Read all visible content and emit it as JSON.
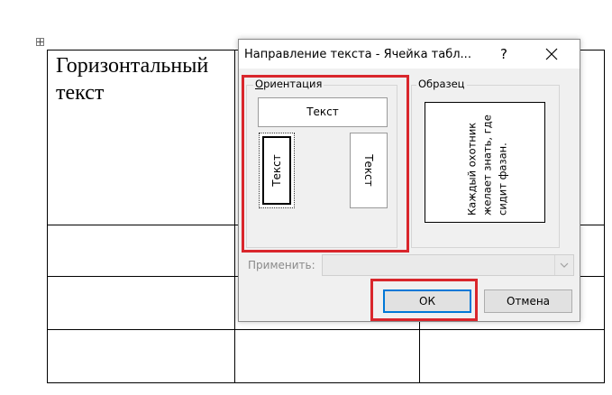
{
  "document": {
    "cell_text": [
      "Горизонтальный",
      "текст"
    ],
    "table_move_handle": "move-arrows-icon"
  },
  "dialog": {
    "title": "Направление текста - Ячейка табл...",
    "help_label": "?",
    "close_icon": "close-icon",
    "orientation": {
      "label_accel": "О",
      "label_rest": "риентация",
      "options": [
        {
          "label": "Текст",
          "direction": "horizontal"
        },
        {
          "label": "Текст",
          "direction": "bottom-to-top",
          "selected": true
        },
        {
          "label": "Текст",
          "direction": "top-to-bottom"
        }
      ]
    },
    "sample": {
      "label": "Образец",
      "text": "Каждый охотник желает знать, где сидит фазан."
    },
    "apply": {
      "label": "Применить:",
      "value": "",
      "disabled": true
    },
    "buttons": {
      "ok": "ОК",
      "cancel": "Отмена"
    }
  },
  "highlight_color": "#d9262c",
  "focus_color": "#0078d7"
}
